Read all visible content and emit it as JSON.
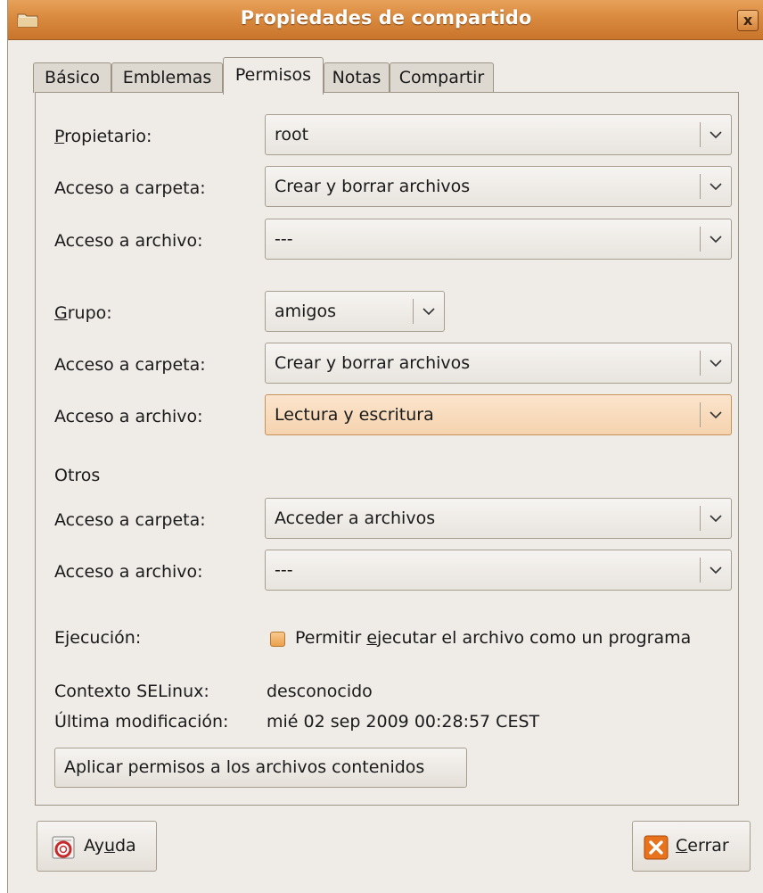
{
  "window": {
    "title": "Propiedades de compartido",
    "close_glyph": "x"
  },
  "tabs": [
    {
      "label": "Básico",
      "active": false
    },
    {
      "label": "Emblemas",
      "active": false
    },
    {
      "label": "Permisos",
      "active": true
    },
    {
      "label": "Notas",
      "active": false
    },
    {
      "label": "Compartir",
      "active": false
    }
  ],
  "owner": {
    "label_underlined": "P",
    "label_rest": "ropietario:",
    "value": "root",
    "folder_access_label": "Acceso a carpeta:",
    "folder_access_value": "Crear y borrar archivos",
    "file_access_label": "Acceso a archivo:",
    "file_access_value": "---"
  },
  "group": {
    "label_underlined": "G",
    "label_rest": "rupo:",
    "value": "amigos",
    "folder_access_label": "Acceso a carpeta:",
    "folder_access_value": "Crear y borrar archivos",
    "file_access_label": "Acceso a archivo:",
    "file_access_value": "Lectura y escritura"
  },
  "others": {
    "heading": "Otros",
    "folder_access_label": "Acceso a carpeta:",
    "folder_access_value": "Acceder a archivos",
    "file_access_label": "Acceso a archivo:",
    "file_access_value": "---"
  },
  "execution": {
    "label": "Ejecución:",
    "checkbox_pre": "Permitir ",
    "checkbox_underlined": "e",
    "checkbox_post": "jecutar el archivo como un programa",
    "checked": false
  },
  "selinux": {
    "label": "Contexto SELinux:",
    "value": "desconocido"
  },
  "modified": {
    "label": "Última modificación:",
    "value": "mié 02 sep 2009 00:28:57 CEST"
  },
  "apply_button": "Aplicar permisos a los archivos contenidos",
  "help_button": {
    "pre": "Ay",
    "underlined": "u",
    "post": "da",
    "icon": "help-lifebuoy-icon"
  },
  "close_button": {
    "underlined": "C",
    "post": "errar",
    "icon": "close-x-icon"
  },
  "colors": {
    "titlebar": "#d98a3e",
    "window_bg": "#efebe7",
    "focused_combo": "#f5d3ae",
    "checkbox": "#eaa14d",
    "close_icon": "#e8731c"
  }
}
